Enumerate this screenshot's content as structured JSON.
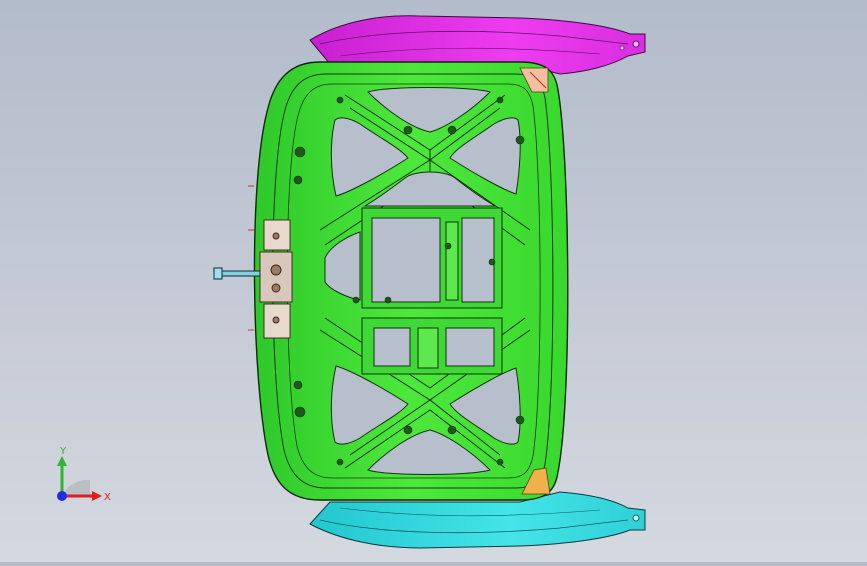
{
  "viewport": {
    "background_top": "#b3bccb",
    "background_bottom": "#d4d8df"
  },
  "model": {
    "inner_panel_color": "#39e02c",
    "top_flange_color": "#e12ee6",
    "bottom_flange_color": "#35d7dc",
    "latch_bracket_color": "#e8d9cf",
    "gusset_color": "#f2b04b"
  },
  "triad": {
    "x_label": "X",
    "y_label": "Y",
    "x_color": "#e01e1e",
    "y_color": "#2fb52f",
    "z_color": "#1e2fe0"
  }
}
